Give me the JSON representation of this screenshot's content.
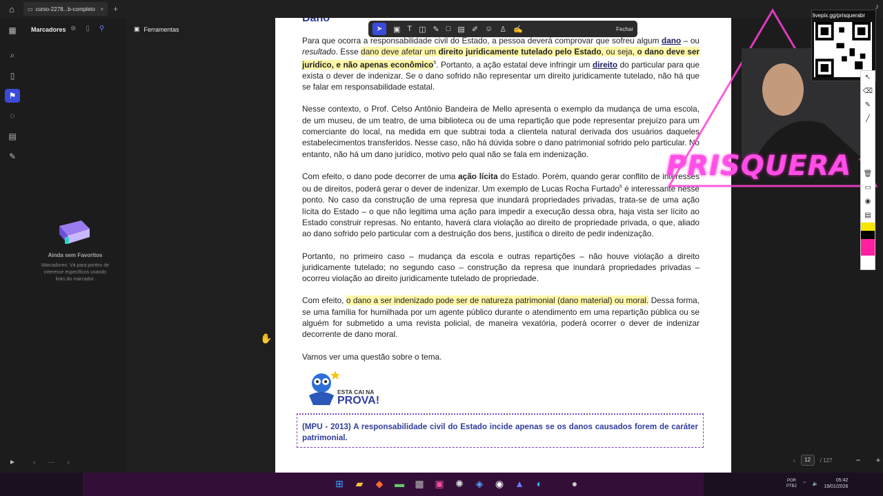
{
  "browser": {
    "tab_title": "curso-2278...b-completo",
    "tab_close": "×",
    "new_tab": "+"
  },
  "sidebar": {
    "title": "Marcadores",
    "tools_label": "Ferramentas",
    "empty_title": "Ainda sem Favoritos",
    "empty_desc": "Marcadores: Vá para pontos de interesse específicos usando links do marcador.",
    "nav_more": "···"
  },
  "toolbar": {
    "close_label": "Fechar"
  },
  "document": {
    "heading": "Dano",
    "p1_a": "Para que ocorra a responsabilidade civil do Estado, a pessoa deverá comprovar que sofreu algum ",
    "p1_dano": "dano",
    "p1_b": " – ou ",
    "p1_resultado": "resultado",
    "p1_c": ". Esse ",
    "p1_hl1": "dano deve afetar um ",
    "p1_hl_bold": "direito juridicamente tutelado pelo Estado",
    "p1_hl2": ", ou seja, ",
    "p1_hl_bold2": "o dano deve ser jurídico, e não apenas econômico",
    "p1_sup": "5",
    "p1_d": ". Portanto, a ação estatal deve infringir um ",
    "p1_direito": "direito",
    "p1_e": " do particular para que exista o dever de indenizar. Se o dano sofrido não representar um direito juridicamente tutelado, não há que se falar em responsabilidade estatal.",
    "p2": "Nesse contexto, o Prof. Celso Antônio Bandeira de Mello apresenta o exemplo da mudança de uma escola, de um museu, de um teatro, de uma biblioteca ou de uma repartição que pode representar prejuízo para um comerciante do local, na medida em que subtrai toda a clientela natural derivada dos usuários daqueles estabelecimentos transferidos. Nesse caso, não há dúvida sobre o dano patrimonial sofrido pelo particular. No entanto, não há um dano jurídico, motivo pelo qual não se fala em indenização.",
    "p3_a": "Com efeito, o dano pode decorrer de uma ",
    "p3_bold": "ação lícita",
    "p3_b": " do Estado. Porém, quando gerar conflito de interesses ou de direitos, poderá gerar o dever de indenizar. Um exemplo de Lucas Rocha Furtado",
    "p3_sup": "6",
    "p3_c": " é interessante nesse ponto. No caso da construção de uma represa que inundará propriedades privadas, trata-se de uma ação lícita do Estado – o que não legitima uma ação para impedir a execução dessa obra, haja vista ser lícito ao Estado construir represas. No entanto, haverá clara violação ao direito de propriedade privada, o que, aliado ao dano sofrido pelo particular com a destruição dos bens, justifica o direito de pedir indenização.",
    "p4": "Portanto, no primeiro caso – mudança da escola e outras repartições – não houve violação a direito juridicamente tutelado; no segundo caso – construção da represa que inundará propriedades privadas – ocorreu violação ao direito juridicamente tutelado de propriedade.",
    "p5_a": "Com efeito, ",
    "p5_hl": "o dano a ser indenizado pode ser de natureza patrimonial (dano material) ou moral.",
    "p5_b": " Dessa forma, se uma família for humilhada por um agente público durante o atendimento em uma repartição pública ou se alguém for submetido a uma revista policial, de maneira vexatória, poderá ocorrer o dever de indenizar decorrente de dano moral.",
    "p6": "Vamos ver uma questão sobre o tema.",
    "cai_line1": "ESTA CAI NA",
    "cai_line2": "PROVA!",
    "question": "(MPU - 2013) A responsabilidade civil do Estado incide apenas se os danos causados forem de caráter patrimonial."
  },
  "stream": {
    "url": "livepix.gg/prisquerabr",
    "name": "PRISQUERA"
  },
  "pager": {
    "current_page": "12",
    "total_pages": "/ 127",
    "zoom_out": "−",
    "zoom_in": "+"
  },
  "tray": {
    "lang1": "POR",
    "lang2": "PTB2",
    "time": "05:42",
    "date": "19/01/2026"
  },
  "colors": {
    "accent": "#3a4bd9",
    "highlight": "#fff6a8",
    "stream_pink": "#ff4fe6"
  }
}
